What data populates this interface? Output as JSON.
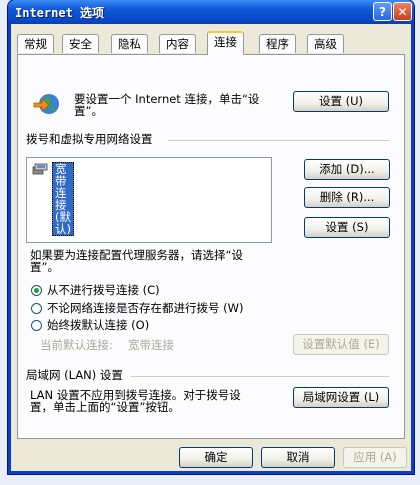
{
  "window": {
    "title": "Internet 选项",
    "help": "?",
    "close": "✕"
  },
  "tabs": [
    "常规",
    "安全",
    "隐私",
    "内容",
    "连接",
    "程序",
    "高级"
  ],
  "setup": {
    "text_line1": "要设置一个 Internet 连接，单击“设",
    "text_line2": "置”。",
    "button": "设置 (U)"
  },
  "dialup": {
    "header": "拨号和虚拟专用网络设置",
    "list_item": "宽带连接 (默认)",
    "add": "添加 (D)...",
    "remove": "删除 (R)...",
    "settings": "设置 (S)"
  },
  "proxy_note": {
    "line1": "如果要为连接配置代理服务器，请选择“设",
    "line2": "置”。"
  },
  "radios": [
    {
      "label": "从不进行拨号连接 (C)",
      "selected": true
    },
    {
      "label": "不论网络连接是否存在都进行拨号 (W)",
      "selected": false
    },
    {
      "label": "始终拨默认连接 (O)",
      "selected": false
    }
  ],
  "current_default": {
    "label": "当前默认连接:",
    "value": "宽带连接",
    "button": "设置默认值 (E)"
  },
  "lan": {
    "header": "局域网 (LAN) 设置",
    "line1": "LAN 设置不应用到拨号连接。对于拨号设",
    "line2": "置，单击上面的“设置”按钮。",
    "button": "局域网设置 (L)"
  },
  "footer": {
    "ok": "确定",
    "cancel": "取消",
    "apply": "应用 (A)"
  }
}
